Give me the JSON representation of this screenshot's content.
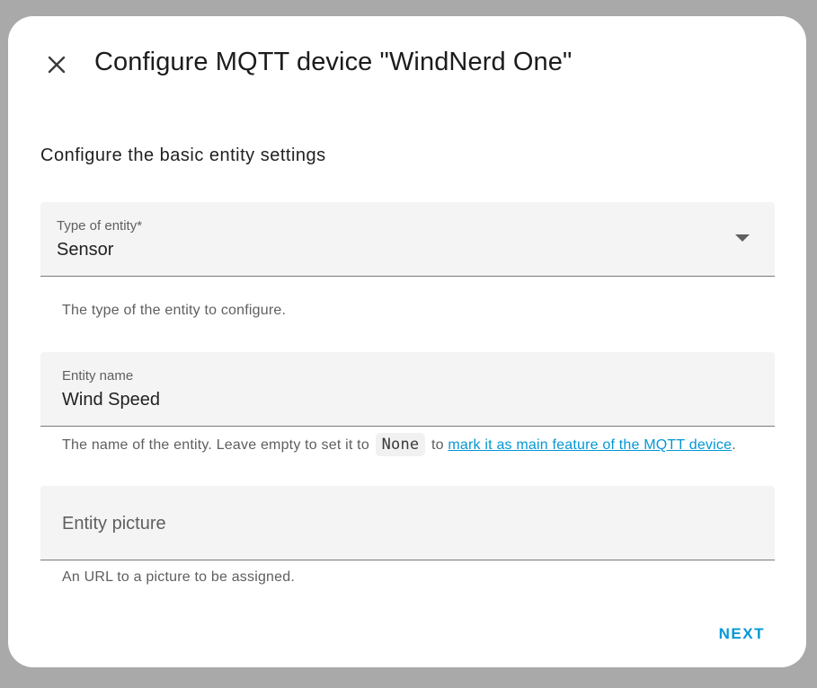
{
  "dialog": {
    "title": "Configure MQTT device \"WindNerd One\"",
    "close_icon": "close-icon"
  },
  "form": {
    "heading": "Configure the basic entity settings",
    "entity_type": {
      "label": "Type of entity*",
      "value": "Sensor",
      "helper": "The type of the entity to configure.",
      "icon": "chevron-down-icon"
    },
    "entity_name": {
      "label": "Entity name",
      "value": "Wind Speed",
      "helper_prefix": "The name of the entity. Leave empty to set it to",
      "helper_code": "None",
      "helper_mid": "to",
      "helper_link": "mark it as main feature of the MQTT device",
      "helper_suffix": "."
    },
    "entity_picture": {
      "label": "Entity picture",
      "value": "",
      "helper": "An URL to a picture to be assigned."
    }
  },
  "actions": {
    "next_label": "NEXT"
  },
  "colors": {
    "accent": "#0397d6",
    "backdrop": "#a9a9a9",
    "field_bg": "#f4f4f4"
  }
}
